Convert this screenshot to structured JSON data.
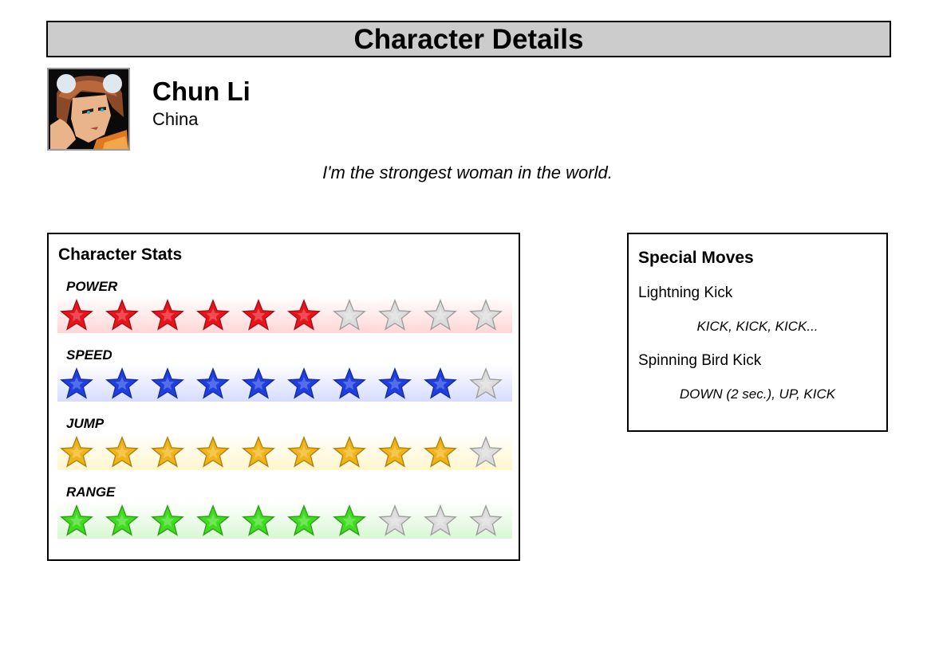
{
  "header": {
    "title": "Character Details"
  },
  "character": {
    "name": "Chun Li",
    "country": "China",
    "quote": "I'm the strongest woman in the world."
  },
  "stats": {
    "title": "Character Stats",
    "max_stars": 10,
    "items": [
      {
        "label": "POWER",
        "value": 6,
        "color": "#e8141c",
        "track_color": "#ffd6d6"
      },
      {
        "label": "SPEED",
        "value": 9,
        "color": "#1f3fe0",
        "track_color": "#d6dcff"
      },
      {
        "label": "JUMP",
        "value": 9,
        "color": "#f0b418",
        "track_color": "#fff6cc"
      },
      {
        "label": "RANGE",
        "value": 7,
        "color": "#3fdc1f",
        "track_color": "#d9f7d4"
      }
    ],
    "empty_color": "#dcdcdc"
  },
  "moves": {
    "title": "Special Moves",
    "items": [
      {
        "name": "Lightning Kick",
        "input": "KICK, KICK, KICK..."
      },
      {
        "name": "Spinning Bird Kick",
        "input": "DOWN (2 sec.), UP, KICK"
      }
    ]
  }
}
